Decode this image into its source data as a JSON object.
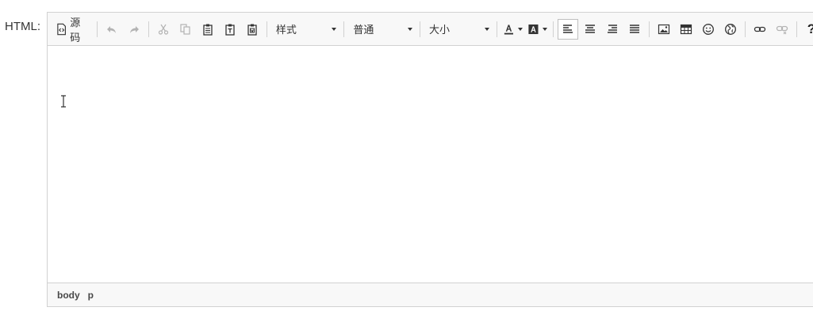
{
  "field": {
    "label": "HTML:"
  },
  "toolbar": {
    "source_label": "源码",
    "styles": {
      "label": "样式"
    },
    "format": {
      "label": "普通"
    },
    "size": {
      "label": "大小"
    },
    "help_label": "?"
  },
  "statusbar": {
    "path": [
      "body",
      "p"
    ]
  },
  "colors": {
    "toolbar_bg": "#f8f8f8",
    "border": "#d1d1d1",
    "disabled_icon": "#b3b3b3"
  }
}
